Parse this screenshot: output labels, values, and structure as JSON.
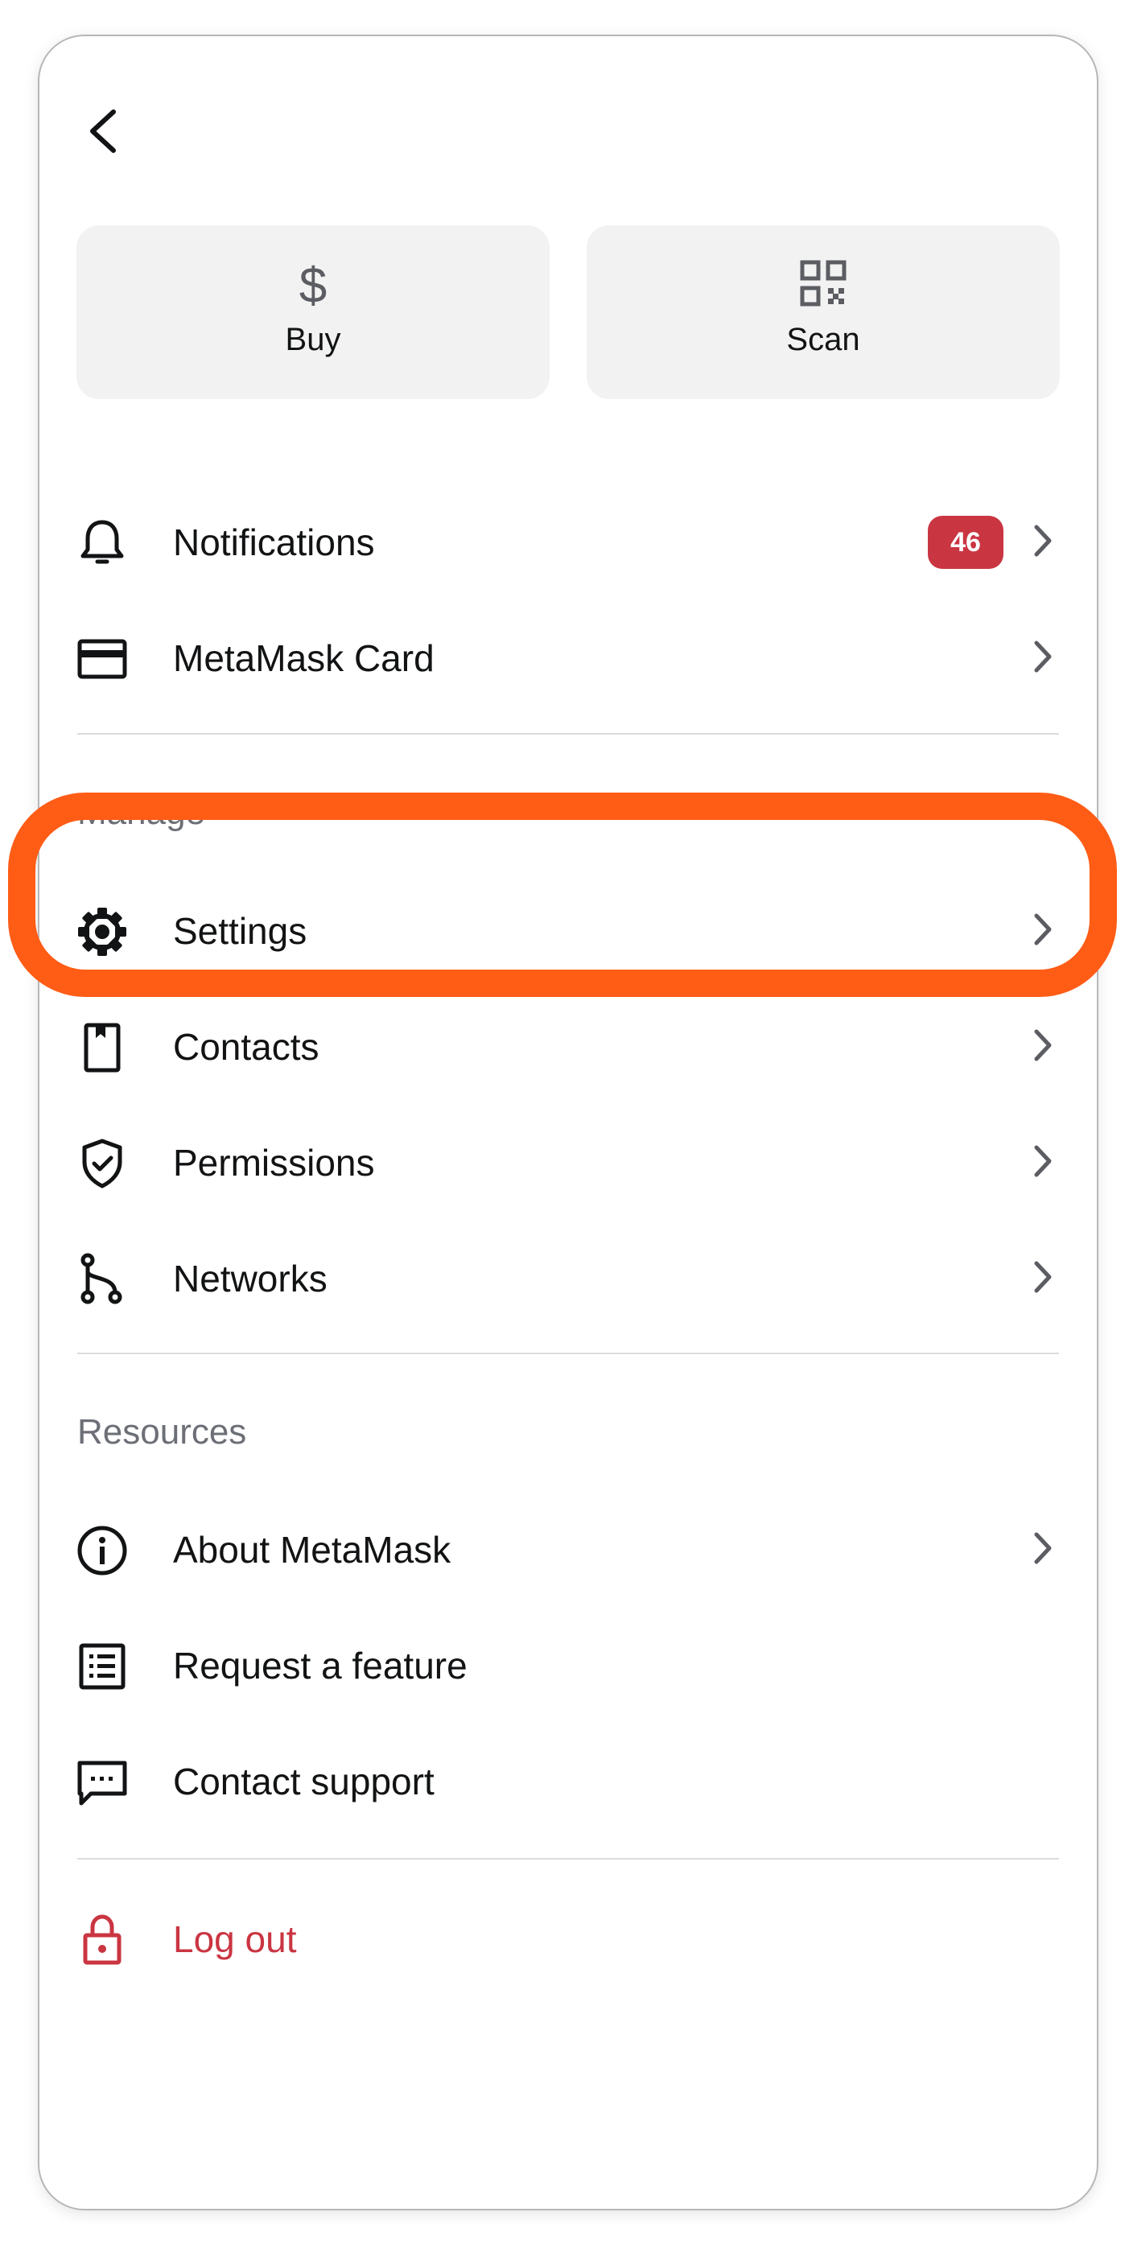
{
  "quick_actions": {
    "buy_label": "Buy",
    "scan_label": "Scan"
  },
  "menu": {
    "notifications": {
      "label": "Notifications",
      "badge": "46"
    },
    "card": {
      "label": "MetaMask Card"
    }
  },
  "manage": {
    "title": "Manage",
    "settings": "Settings",
    "contacts": "Contacts",
    "permissions": "Permissions",
    "networks": "Networks"
  },
  "resources": {
    "title": "Resources",
    "about": "About MetaMask",
    "request_feature": "Request a feature",
    "contact_support": "Contact support"
  },
  "logout": {
    "label": "Log out"
  },
  "colors": {
    "accent_highlight": "#ff5c16",
    "danger": "#ca3542",
    "tile_bg": "#f2f2f2",
    "muted_text": "#6c6f76"
  },
  "icons": {
    "back": "chevron-left-icon",
    "buy": "dollar-icon",
    "scan": "qr-code-icon",
    "notifications": "bell-icon",
    "card": "card-icon",
    "settings": "gear-icon",
    "contacts": "book-icon",
    "permissions": "shield-check-icon",
    "networks": "network-icon",
    "about": "info-icon",
    "request_feature": "list-icon",
    "contact_support": "message-icon",
    "logout": "lock-icon",
    "chevron": "chevron-right-icon"
  }
}
